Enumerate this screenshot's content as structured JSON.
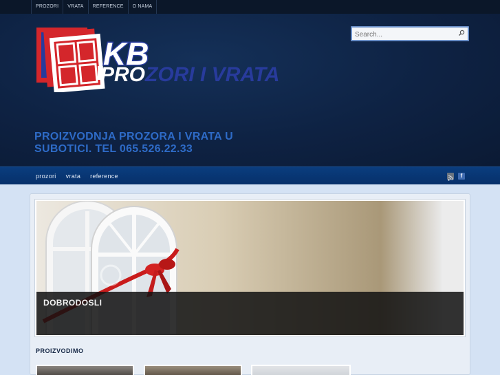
{
  "top_menu": [
    "PROZORI",
    "VRATA",
    "REFERENCE",
    "O NAMA"
  ],
  "logo": {
    "letters": "KB",
    "text_pro": "PRO",
    "text_rest": "ZORI I VRATA",
    "colors": {
      "red": "#d4262b",
      "blue": "#283b9c",
      "white": "#ffffff"
    }
  },
  "search": {
    "placeholder": "Search...",
    "icon": "magnifier-icon"
  },
  "tagline": "PROIZVODNJA PROZORA I VRATA U SUBOTICI. TEL 065.526.22.33",
  "nav": [
    "prozori",
    "vrata",
    "reference"
  ],
  "social": [
    "rss-icon",
    "facebook-icon"
  ],
  "slider": {
    "caption": "DOBRODOSLI"
  },
  "section": {
    "title": "PROIZVODIMO"
  },
  "colors": {
    "header_bg": "#0e2243",
    "nav_bg": "#0a3d7e",
    "tagline": "#2e6bc7",
    "page_bg": "#d4e2f4"
  }
}
